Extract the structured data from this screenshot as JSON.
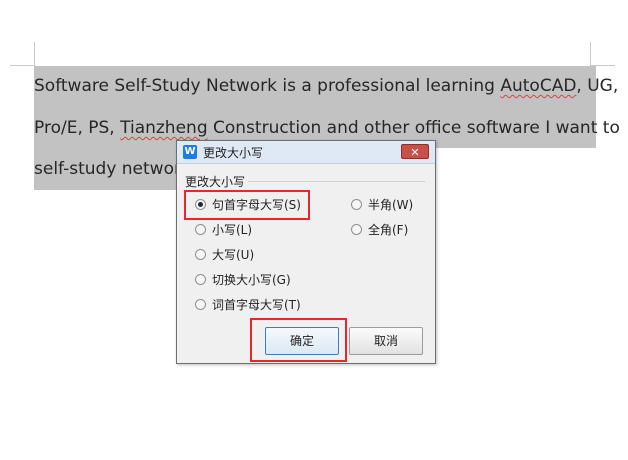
{
  "document": {
    "line1_a": "Software Self-Study Network is a professional learning ",
    "line1_b": "AutoCAD",
    "line1_c": ", UG,",
    "line2_a": "Pro/E, PS, ",
    "line2_b": "Tianzheng",
    "line2_c": " Construction and other office software I want to",
    "line3": "self-study network"
  },
  "dialog": {
    "title": "更改大小写",
    "app_icon_letter": "W",
    "close_glyph": "✕",
    "group_label": "更改大小写",
    "options_left": [
      {
        "label": "句首字母大写(S)",
        "checked": true
      },
      {
        "label": "小写(L)",
        "checked": false
      },
      {
        "label": "大写(U)",
        "checked": false
      },
      {
        "label": "切换大小写(G)",
        "checked": false
      },
      {
        "label": "词首字母大写(T)",
        "checked": false
      }
    ],
    "options_right": [
      {
        "label": "半角(W)",
        "checked": false
      },
      {
        "label": "全角(F)",
        "checked": false
      }
    ],
    "ok_label": "确定",
    "cancel_label": "取消"
  },
  "colors": {
    "selection": "#c2c2c2",
    "highlight_box": "#e8262b",
    "titlebar": "#dfe9f5"
  }
}
